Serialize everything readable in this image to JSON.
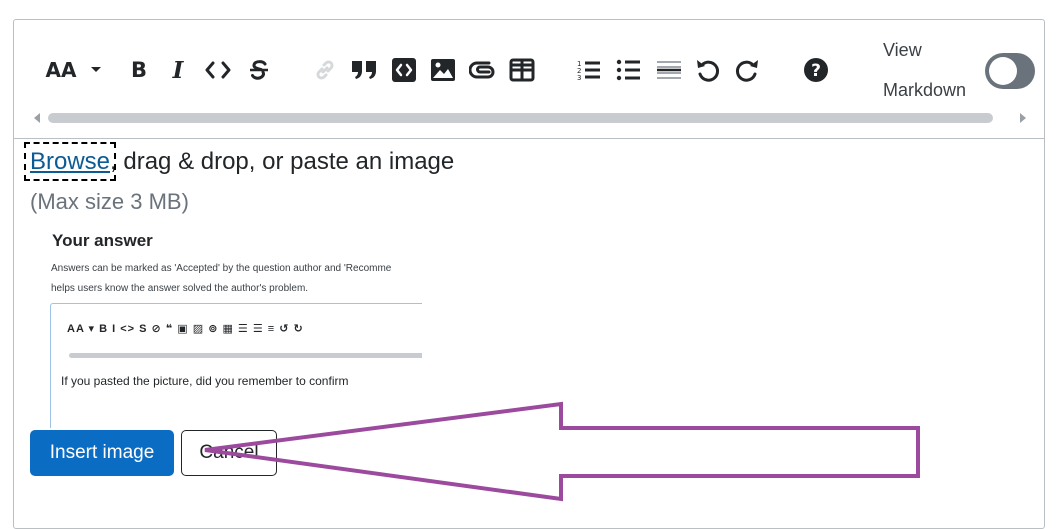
{
  "toolbar": {
    "heading_label": "AA",
    "bold_label": "B",
    "italic_label": "I",
    "view_label": "View",
    "markdown_label": "Markdown",
    "icons": [
      "heading-icon",
      "chevron-down-icon",
      "bold-icon",
      "italic-icon",
      "code-icon",
      "strikethrough-icon",
      "link-icon",
      "blockquote-icon",
      "code-block-icon",
      "image-icon",
      "attachment-icon",
      "table-icon",
      "ordered-list-icon",
      "unordered-list-icon",
      "horizontal-rule-icon",
      "undo-icon",
      "redo-icon",
      "help-icon"
    ]
  },
  "upload": {
    "browse_label": "Browse",
    "prompt_rest": ", drag & drop, or paste an image",
    "max_size": "(Max size 3 MB)"
  },
  "preview": {
    "title": "Your answer",
    "line1": "Answers can be marked as 'Accepted' by the question author and 'Recomme",
    "line2": "helps users know the answer solved the author's problem.",
    "toolbar_text": "AA ▾  B I <> S   ⊘ ❝ ▣ ▨ ⊚ ▦   ☰ ☰ ≡ ↺ ↻",
    "body_text": "If you pasted the picture, did you remember to confirm"
  },
  "buttons": {
    "insert": "Insert image",
    "cancel": "Cancel"
  },
  "colors": {
    "accent": "#0a6cc2",
    "link": "#0c5b92",
    "arrow": "#9b4a9e",
    "border": "#babfc4"
  }
}
